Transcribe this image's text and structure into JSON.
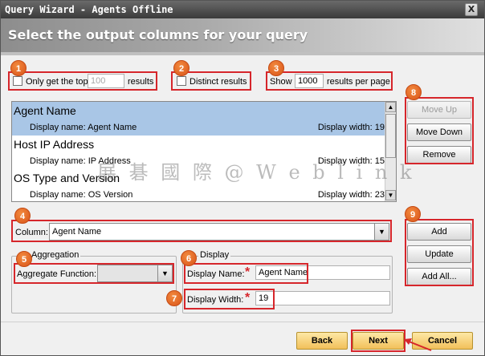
{
  "window": {
    "title": "Query Wizard - Agents Offline",
    "close_label": "X"
  },
  "header": {
    "title": "Select the output columns for your query"
  },
  "options": {
    "only_top_label": "Only get the top",
    "only_top_value": "100",
    "results_label": "results",
    "distinct_label": "Distinct results",
    "show_label": "Show",
    "show_value": "1000",
    "per_page_label": "results per page"
  },
  "columns_list": {
    "items": [
      {
        "name": "Agent Name",
        "display_name": "Display name: Agent Name",
        "display_width": "Display width: 19",
        "selected": true
      },
      {
        "name": "Host IP Address",
        "display_name": "Display name: IP Address",
        "display_width": "Display width: 15",
        "selected": false
      },
      {
        "name": "OS Type and Version",
        "display_name": "Display name: OS Version",
        "display_width": "Display width: 23",
        "selected": false
      }
    ]
  },
  "side_buttons": {
    "move_up": "Move Up",
    "move_down": "Move Down",
    "remove": "Remove"
  },
  "column": {
    "label": "Column:",
    "value": "Agent Name"
  },
  "aggregation": {
    "legend": "Aggregation",
    "label": "Aggregate Function:",
    "value": ""
  },
  "display": {
    "legend": "Display",
    "name_label": "Display Name:",
    "name_value": "Agent Name",
    "width_label": "Display Width:",
    "width_value": "19",
    "required_mark": "*"
  },
  "action_buttons": {
    "add": "Add",
    "update": "Update",
    "add_all": "Add All..."
  },
  "footer": {
    "back": "Back",
    "next": "Next",
    "cancel": "Cancel"
  },
  "callouts": [
    "1",
    "2",
    "3",
    "4",
    "5",
    "6",
    "7",
    "8",
    "9"
  ],
  "watermark": "展 碁  國 際 @ W e b l i n k",
  "icons": {
    "arrow_up": "▲",
    "arrow_down": "▼"
  },
  "colors": {
    "highlight": "#d6262b",
    "callout": "#e8672a",
    "selection": "#a9c6e6"
  }
}
